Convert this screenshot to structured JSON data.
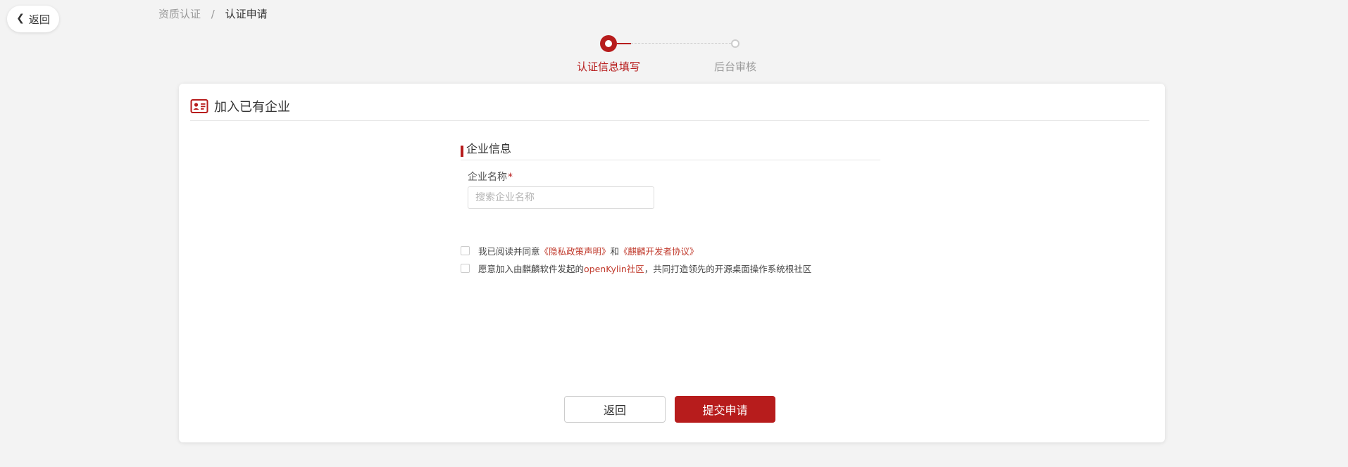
{
  "top_back": {
    "label": "返回"
  },
  "breadcrumb": {
    "items": [
      "资质认证",
      "认证申请"
    ],
    "separator": "/"
  },
  "steps": [
    {
      "label": "认证信息填写",
      "status": "active"
    },
    {
      "label": "后台审核",
      "status": "pending"
    }
  ],
  "card": {
    "title": "加入已有企业",
    "icon": "id-card-icon"
  },
  "section": {
    "title": "企业信息"
  },
  "form": {
    "company_name": {
      "label": "企业名称",
      "required_mark": "*",
      "placeholder": "搜索企业名称",
      "value": ""
    }
  },
  "agreements": [
    {
      "prefix": "我已阅读并同意",
      "link1": "《隐私政策声明》",
      "middle": "和",
      "link2": "《麒麟开发者协议》",
      "checked": false
    },
    {
      "prefix": "愿意加入由麒麟软件发起的",
      "link": "openKylin社区",
      "suffix": "，共同打造领先的开源桌面操作系统根社区",
      "checked": false
    }
  ],
  "buttons": {
    "back": "返回",
    "submit": "提交申请"
  },
  "colors": {
    "accent": "#b71c1c",
    "link": "#c0392b",
    "background": "#f3f3f3"
  }
}
